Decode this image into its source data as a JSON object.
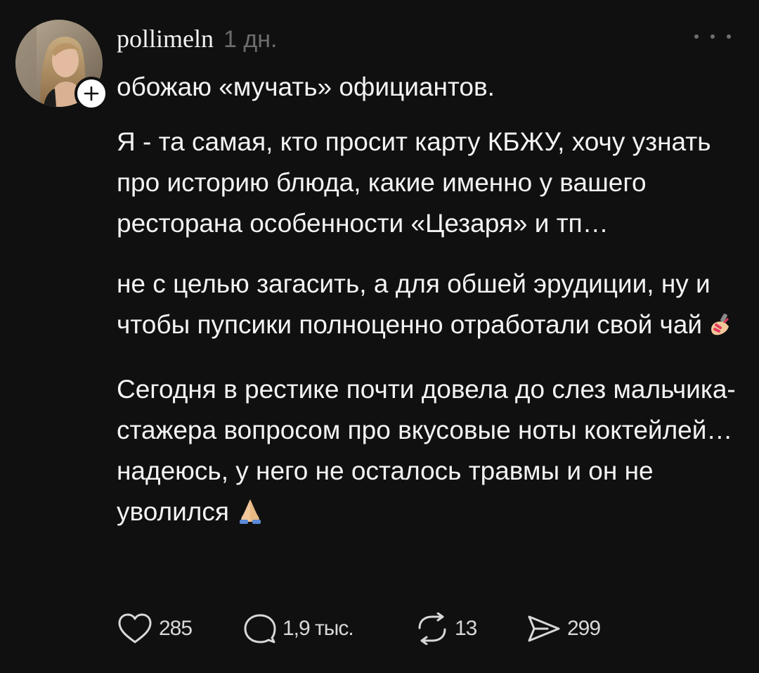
{
  "post": {
    "username": "pollimeln",
    "time": "1 дн.",
    "lead": "обожаю «мучать» официантов.",
    "paragraphs": [
      "Я - та самая, кто просит карту КБЖУ, хочу узнать про историю блюда, какие именно у вашего ресторана особенности «Цезаря» и тп…",
      "не с целью загасить, а для обшей эрудиции, ну и чтобы пупсики полноценно отработали свой чай",
      "Сегодня в рестике почти довела до слез мальчика-стажера вопросом про вкусовые ноты коктейлей… надеюсь, у него не осталось травмы и он не уволился"
    ],
    "emojis": [
      "nail-polish-emoji",
      "praying-hands-emoji"
    ]
  },
  "actions": {
    "likes": "285",
    "replies": "1,9 тыс.",
    "reposts": "13",
    "shares": "299"
  },
  "icons": {
    "more": "more-options-icon",
    "follow": "plus-icon",
    "like": "heart-icon",
    "reply": "comment-bubble-icon",
    "repost": "repost-arrows-icon",
    "share": "send-arrow-icon"
  },
  "colors": {
    "background": "#101010",
    "text": "#f3f3f3",
    "muted": "#6d6d6d"
  }
}
